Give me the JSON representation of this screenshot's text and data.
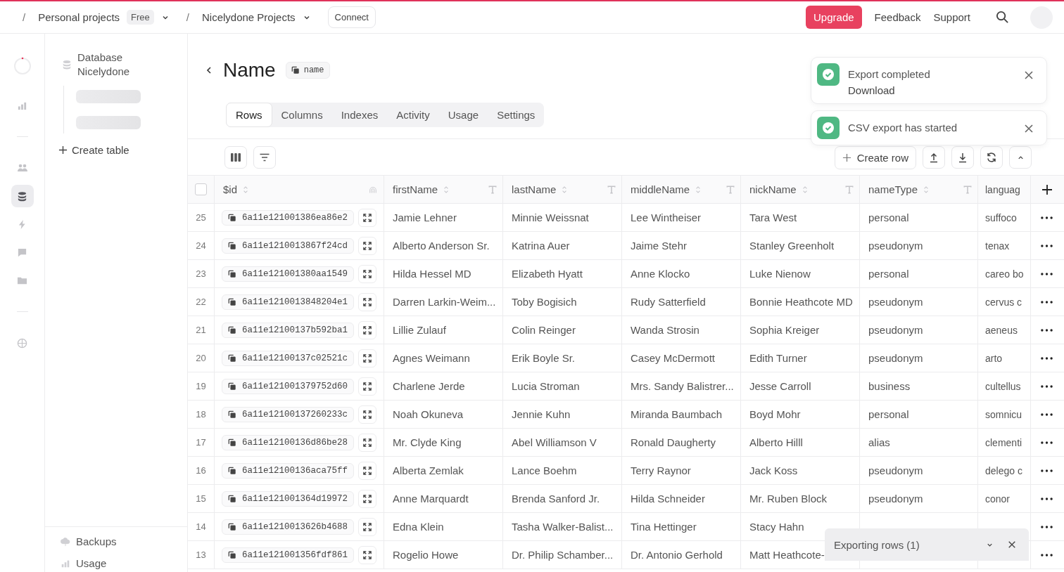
{
  "topbar": {
    "breadcrumbs": [
      {
        "separator": "/",
        "label": "Personal projects",
        "badge": "Free"
      },
      {
        "separator": "/",
        "label": "Nicelydone Projects"
      }
    ],
    "connect": "Connect",
    "upgrade": "Upgrade",
    "links": [
      "Feedback",
      "Support"
    ]
  },
  "rail": {
    "groups": [
      {
        "items": [
          {
            "kind": "loading",
            "selected": false
          },
          {
            "kind": "chart",
            "selected": false
          }
        ]
      },
      {
        "items": [
          {
            "kind": "people",
            "selected": false
          },
          {
            "kind": "database",
            "selected": true
          },
          {
            "kind": "bolt",
            "selected": false
          },
          {
            "kind": "chat",
            "selected": false
          },
          {
            "kind": "folder",
            "selected": false
          }
        ]
      },
      {
        "items": [
          {
            "kind": "globe",
            "selected": false
          }
        ]
      }
    ]
  },
  "sidebar": {
    "database": "Database Nicelydone",
    "create_table": "Create table",
    "footer": [
      {
        "label": "Backups",
        "kind": "backup"
      },
      {
        "label": "Usage",
        "kind": "usage"
      }
    ]
  },
  "page": {
    "title": "Name",
    "id_badge": "name",
    "tabs": [
      {
        "label": "Rows",
        "selected": true
      },
      {
        "label": "Columns",
        "selected": false
      },
      {
        "label": "Indexes",
        "selected": false
      },
      {
        "label": "Activity",
        "selected": false
      },
      {
        "label": "Usage",
        "selected": false
      },
      {
        "label": "Settings",
        "selected": false
      }
    ]
  },
  "toolbar": {
    "create_row": "Create row"
  },
  "table": {
    "select_all_checked": false,
    "id_column": {
      "label": "$id"
    },
    "columns": [
      {
        "label": "firstName",
        "kind": "text"
      },
      {
        "label": "lastName",
        "kind": "text"
      },
      {
        "label": "middleName",
        "kind": "text"
      },
      {
        "label": "nickName",
        "kind": "text"
      },
      {
        "label": "nameType",
        "kind": "text"
      },
      {
        "label": "languag",
        "kind": "cut"
      }
    ],
    "rows": [
      {
        "number": "25",
        "id": "6a11e121001386ea86e2",
        "cells": [
          "Jamie Lehner",
          "Minnie Weissnat",
          "Lee Wintheiser",
          "Tara West",
          "personal",
          "suffoco"
        ]
      },
      {
        "number": "24",
        "id": "6a11e1210013867f24cd",
        "cells": [
          "Alberto Anderson Sr.",
          "Katrina Auer",
          "Jaime Stehr",
          "Stanley Greenholt",
          "pseudonym",
          "tenax"
        ]
      },
      {
        "number": "23",
        "id": "6a11e121001380aa1549",
        "cells": [
          "Hilda Hessel MD",
          "Elizabeth Hyatt",
          "Anne Klocko",
          "Luke Nienow",
          "personal",
          "careo bo"
        ]
      },
      {
        "number": "22",
        "id": "6a11e1210013848204e1",
        "cells": [
          "Darren Larkin-Weim...",
          "Toby Bogisich",
          "Rudy Satterfield",
          "Bonnie Heathcote MD",
          "pseudonym",
          "cervus c"
        ]
      },
      {
        "number": "21",
        "id": "6a11e12100137b592ba1",
        "cells": [
          "Lillie Zulauf",
          "Colin Reinger",
          "Wanda Strosin",
          "Sophia Kreiger",
          "pseudonym",
          "aeneus"
        ]
      },
      {
        "number": "20",
        "id": "6a11e12100137c02521c",
        "cells": [
          "Agnes Weimann",
          "Erik Boyle Sr.",
          "Casey McDermott",
          "Edith Turner",
          "pseudonym",
          "arto"
        ]
      },
      {
        "number": "19",
        "id": "6a11e121001379752d60",
        "cells": [
          "Charlene Jerde",
          "Lucia Stroman",
          "Mrs. Sandy Balistrer...",
          "Jesse Carroll",
          "business",
          "cultellus"
        ]
      },
      {
        "number": "18",
        "id": "6a11e12100137260233c",
        "cells": [
          "Noah Okuneva",
          "Jennie Kuhn",
          "Miranda Baumbach",
          "Boyd Mohr",
          "personal",
          "somnicu"
        ]
      },
      {
        "number": "17",
        "id": "6a11e12100136d86be28",
        "cells": [
          "Mr. Clyde King",
          "Abel Williamson V",
          "Ronald Daugherty",
          "Alberto Hilll",
          "alias",
          "clementi"
        ]
      },
      {
        "number": "16",
        "id": "6a11e12100136aca75ff",
        "cells": [
          "Alberta Zemlak",
          "Lance Boehm",
          "Terry Raynor",
          "Jack Koss",
          "pseudonym",
          "delego c"
        ]
      },
      {
        "number": "15",
        "id": "6a11e121001364d19972",
        "cells": [
          "Anne Marquardt",
          "Brenda Sanford Jr.",
          "Hilda Schneider",
          "Mr. Ruben Block",
          "pseudonym",
          "conor"
        ]
      },
      {
        "number": "14",
        "id": "6a11e1210013626b4688",
        "cells": [
          "Edna Klein",
          "Tasha Walker-Balist...",
          "Tina Hettinger",
          "Stacy Hahn",
          null,
          null
        ]
      },
      {
        "number": "13",
        "id": "6a11e121001356fdf861",
        "cells": [
          "Rogelio Howe",
          "Dr. Philip Schamber...",
          "Dr. Antonio Gerhold",
          "Matt Heathcote-",
          null,
          null
        ]
      }
    ]
  },
  "toasts": [
    {
      "title": "Export completed",
      "action": "Download"
    },
    {
      "title": "CSV export has started"
    }
  ],
  "export_panel": {
    "label": "Exporting rows (1)"
  }
}
